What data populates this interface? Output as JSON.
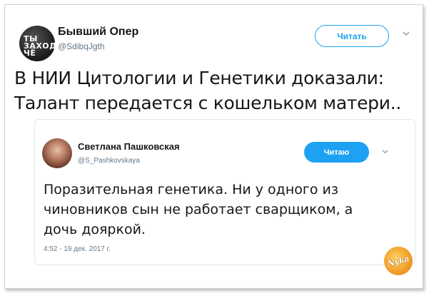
{
  "tweet": {
    "author": {
      "name": "Бывший Опер",
      "handle": "@SdibqJgth",
      "avatar_text": "ТЫ ЗАХОДИ ЧЁ"
    },
    "follow_button_label": "Читать",
    "text_lines": [
      "В НИИ Цитологии и Генетики доказали:",
      "Талант передается с кошельком матери.."
    ]
  },
  "quoted_tweet": {
    "author": {
      "name": "Светлана Пашковская",
      "handle": "@S_Pashkovskaya"
    },
    "follow_button_label": "Читаю",
    "text_lines": [
      "Поразительная генетика. Ни у одного из",
      "чиновников сын не работает сварщиком, а",
      "дочь дояркой."
    ],
    "timestamp": "4:52 - 19 дек. 2017 г."
  },
  "watermark": {
    "text": "Nyka"
  },
  "colors": {
    "accent": "#1da1f2",
    "text": "#14171a",
    "muted": "#657786",
    "border": "#e1e8ed"
  },
  "icons": {
    "menu": "chevron-down-icon"
  }
}
